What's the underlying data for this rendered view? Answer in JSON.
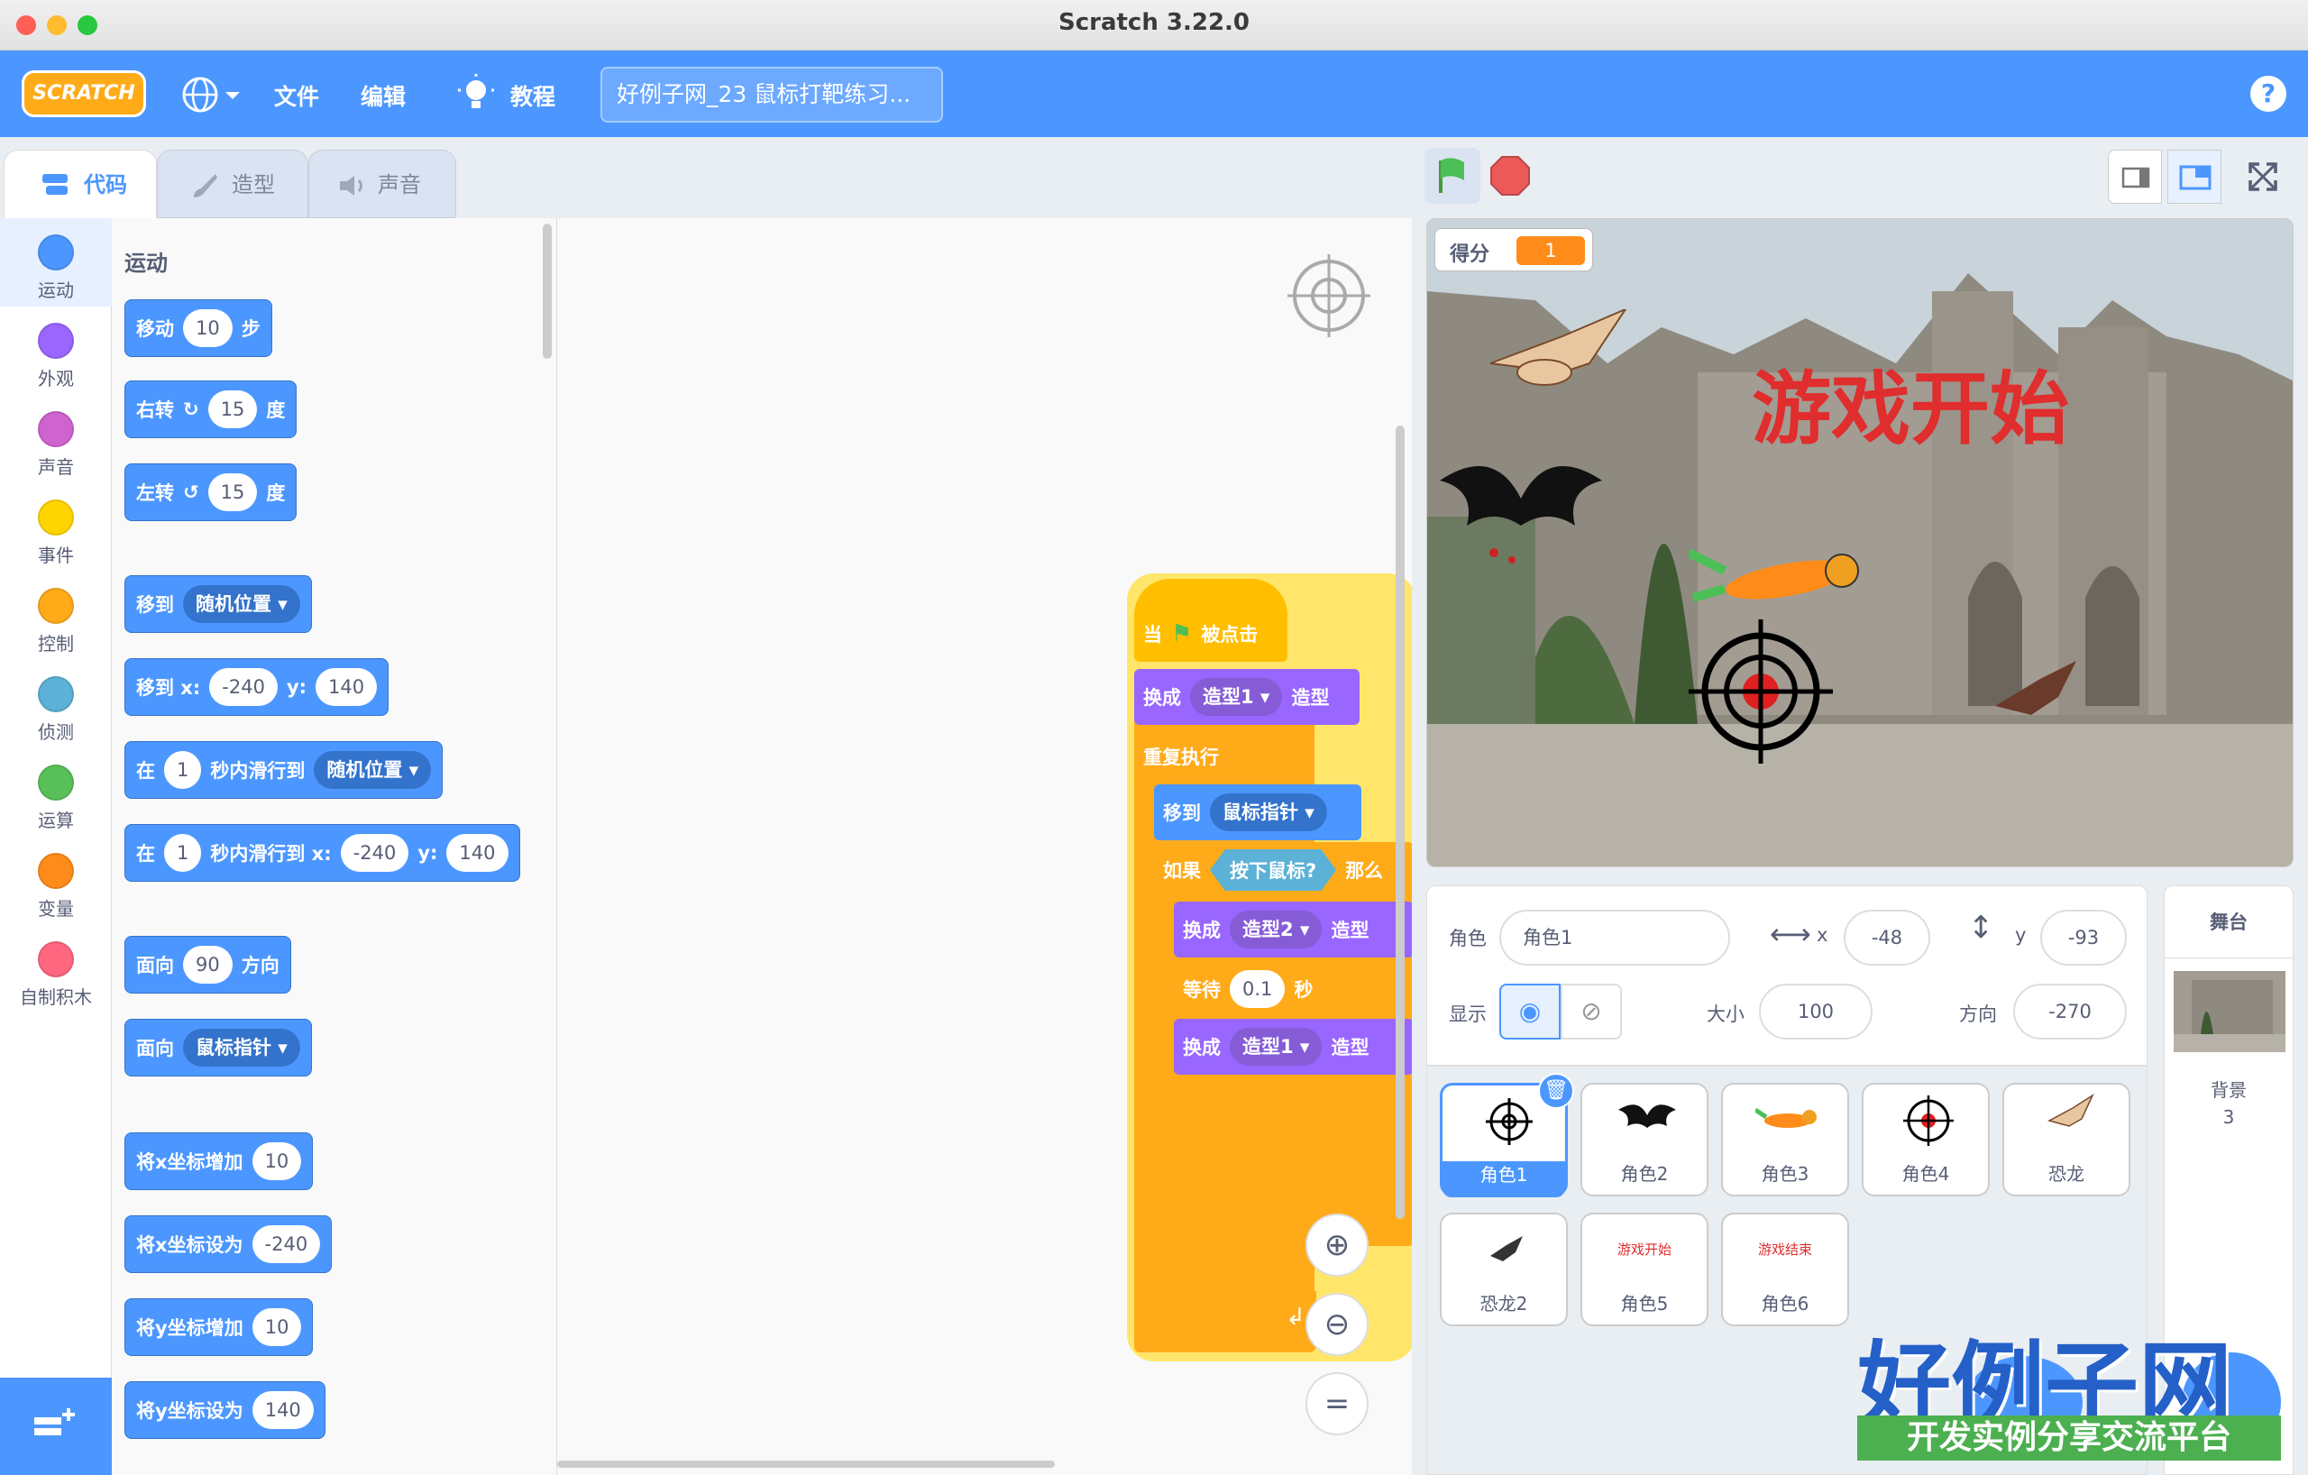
{
  "window": {
    "title": "Scratch 3.22.0"
  },
  "menu": {
    "logo": "SCRATCH",
    "file": "文件",
    "edit": "编辑",
    "tutorials": "教程",
    "project_title": "好例子网_23 鼠标打靶练习...",
    "help": "?"
  },
  "tabs": {
    "code": "代码",
    "costumes": "造型",
    "sounds": "声音"
  },
  "categories": [
    {
      "label": "运动",
      "color": "#4c97ff"
    },
    {
      "label": "外观",
      "color": "#9966ff"
    },
    {
      "label": "声音",
      "color": "#cf63cf"
    },
    {
      "label": "事件",
      "color": "#ffd500"
    },
    {
      "label": "控制",
      "color": "#ffab19"
    },
    {
      "label": "侦测",
      "color": "#5cb1d6"
    },
    {
      "label": "运算",
      "color": "#59c059"
    },
    {
      "label": "变量",
      "color": "#ff8c1a"
    },
    {
      "label": "自制积木",
      "color": "#ff6680"
    }
  ],
  "palette": {
    "heading": "运动",
    "move": {
      "a": "移动",
      "v": "10",
      "b": "步"
    },
    "turn_right": {
      "a": "右转",
      "v": "15",
      "b": "度"
    },
    "turn_left": {
      "a": "左转",
      "v": "15",
      "b": "度"
    },
    "goto": {
      "a": "移到",
      "dd": "随机位置"
    },
    "goto_xy": {
      "a": "移到 x:",
      "x": "-240",
      "b": "y:",
      "y": "140"
    },
    "glide": {
      "a": "在",
      "v": "1",
      "b": "秒内滑行到",
      "dd": "随机位置"
    },
    "glide_xy": {
      "a": "在",
      "v": "1",
      "b": "秒内滑行到 x:",
      "x": "-240",
      "c": "y:",
      "y": "140"
    },
    "point": {
      "a": "面向",
      "v": "90",
      "b": "方向"
    },
    "point_towards": {
      "a": "面向",
      "dd": "鼠标指针"
    },
    "change_x": {
      "a": "将x坐标增加",
      "v": "10"
    },
    "set_x": {
      "a": "将x坐标设为",
      "v": "-240"
    },
    "change_y": {
      "a": "将y坐标增加",
      "v": "10"
    },
    "set_y": {
      "a": "将y坐标设为",
      "v": "140"
    }
  },
  "script": {
    "hat": {
      "a": "当",
      "b": "被点击"
    },
    "switch1": {
      "a": "换成",
      "dd": "造型1",
      "b": "造型"
    },
    "forever": "重复执行",
    "goto": {
      "a": "移到",
      "dd": "鼠标指针"
    },
    "if": {
      "a": "如果",
      "cond": "按下鼠标?",
      "b": "那么"
    },
    "switch2": {
      "a": "换成",
      "dd": "造型2",
      "b": "造型"
    },
    "wait": {
      "a": "等待",
      "v": "0.1",
      "b": "秒"
    },
    "switch3": {
      "a": "换成",
      "dd": "造型1",
      "b": "造型"
    }
  },
  "stage": {
    "score_label": "得分",
    "score_value": "1",
    "game_text": "游戏开始"
  },
  "sprite_info": {
    "sprite_label": "角色",
    "sprite_name": "角色1",
    "x_label": "x",
    "x": "-48",
    "y_label": "y",
    "y": "-93",
    "show_label": "显示",
    "size_label": "大小",
    "size": "100",
    "direction_label": "方向",
    "direction": "-270"
  },
  "sprites": [
    {
      "name": "角色1"
    },
    {
      "name": "角色2"
    },
    {
      "name": "角色3"
    },
    {
      "name": "角色4"
    },
    {
      "name": "恐龙"
    },
    {
      "name": "恐龙2"
    },
    {
      "name": "角色5",
      "thumb_text": "游戏开始"
    },
    {
      "name": "角色6",
      "thumb_text": "游戏结束"
    }
  ],
  "stage_panel": {
    "title": "舞台",
    "backdrop_label": "背景",
    "backdrop_count": "3"
  },
  "watermark": {
    "brand": "好例子网",
    "slogan": "开发实例分享交流平台"
  }
}
